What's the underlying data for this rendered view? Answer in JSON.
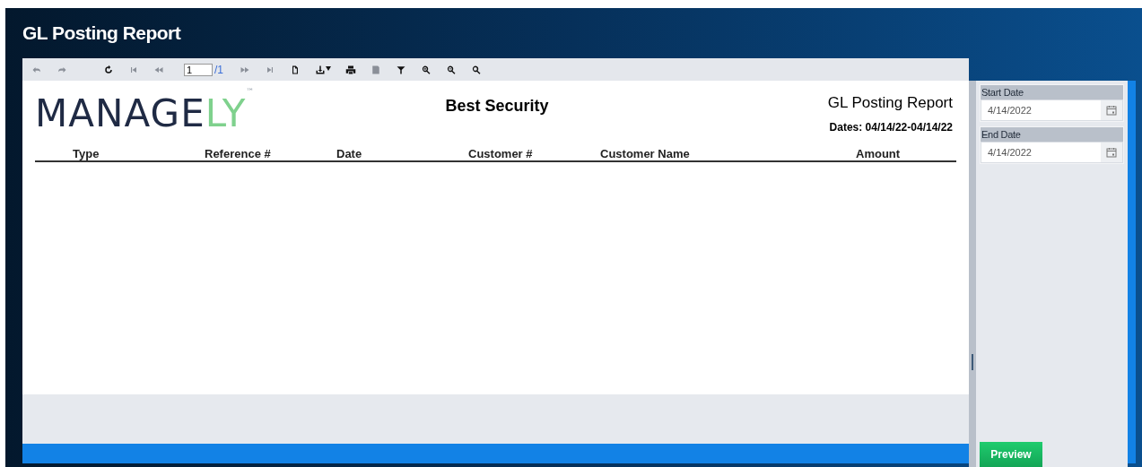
{
  "window": {
    "title": "GL Posting Report"
  },
  "toolbar": {
    "items": [
      {
        "kind": "undo",
        "disabled": true
      },
      {
        "kind": "redo",
        "disabled": true
      },
      {
        "kind": "refresh",
        "disabled": false
      },
      {
        "kind": "first",
        "disabled": true
      },
      {
        "kind": "prev",
        "disabled": true
      },
      {
        "kind": "page"
      },
      {
        "kind": "next",
        "disabled": true
      },
      {
        "kind": "last",
        "disabled": true
      },
      {
        "kind": "page-setup",
        "disabled": false
      },
      {
        "kind": "export",
        "disabled": false
      },
      {
        "kind": "print",
        "disabled": false
      },
      {
        "kind": "print-layout",
        "disabled": true
      },
      {
        "kind": "filter",
        "disabled": false
      },
      {
        "kind": "zoom-in",
        "disabled": false
      },
      {
        "kind": "zoom-out",
        "disabled": false
      },
      {
        "kind": "zoom",
        "disabled": false
      }
    ],
    "page_value": "1",
    "page_total": "/1"
  },
  "report": {
    "logo": {
      "main": "MANAGE",
      "accent": "LY",
      "mark": "™"
    },
    "company": "Best Security",
    "title": "GL Posting Report",
    "dates": "Dates: 04/14/22-04/14/22",
    "columns": [
      "Type",
      "Reference #",
      "Date",
      "Customer #",
      "Customer Name",
      "Amount"
    ]
  },
  "parameters": [
    {
      "label": "Start Date",
      "value": "4/14/2022"
    },
    {
      "label": "End Date",
      "value": "4/14/2022"
    }
  ],
  "preview_button": "Preview"
}
